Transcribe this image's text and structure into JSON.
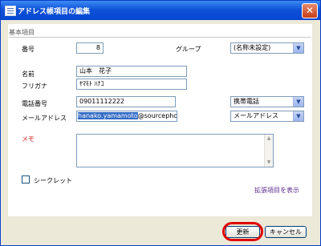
{
  "window": {
    "title": "アドレス帳項目の編集",
    "close_glyph": "✕"
  },
  "section": {
    "title": "基本項目"
  },
  "fields": {
    "number": {
      "label": "番号",
      "value": "8"
    },
    "group": {
      "label": "グループ",
      "value": "(名称未設定)"
    },
    "name": {
      "label": "名前",
      "value": "山本　花子"
    },
    "furigana": {
      "label": "フリガナ",
      "value": "ﾔﾏﾓﾄ ﾊﾅｺ"
    },
    "phone": {
      "label": "電話番号",
      "value": "09011112222",
      "type_value": "携帯電話"
    },
    "email": {
      "label": "メールアドレス",
      "value_selected": "hanako.yamamoto",
      "value_rest": "@sourcephon",
      "type_value": "メールアドレス"
    },
    "memo": {
      "label": "メモ",
      "value": ""
    },
    "secret": {
      "label": "シークレット",
      "checked": false
    }
  },
  "links": {
    "extended": "拡張項目を表示"
  },
  "buttons": {
    "ok": "更新",
    "cancel": "キャンセル"
  },
  "icons": {
    "dropdown_arrow": "▼",
    "scroll_up": "▲",
    "scroll_down": "▼"
  },
  "colors": {
    "titlebar": "#0546d0",
    "highlight_circle": "#e00000",
    "link": "#5a2d8c",
    "required_label": "#e02020"
  }
}
